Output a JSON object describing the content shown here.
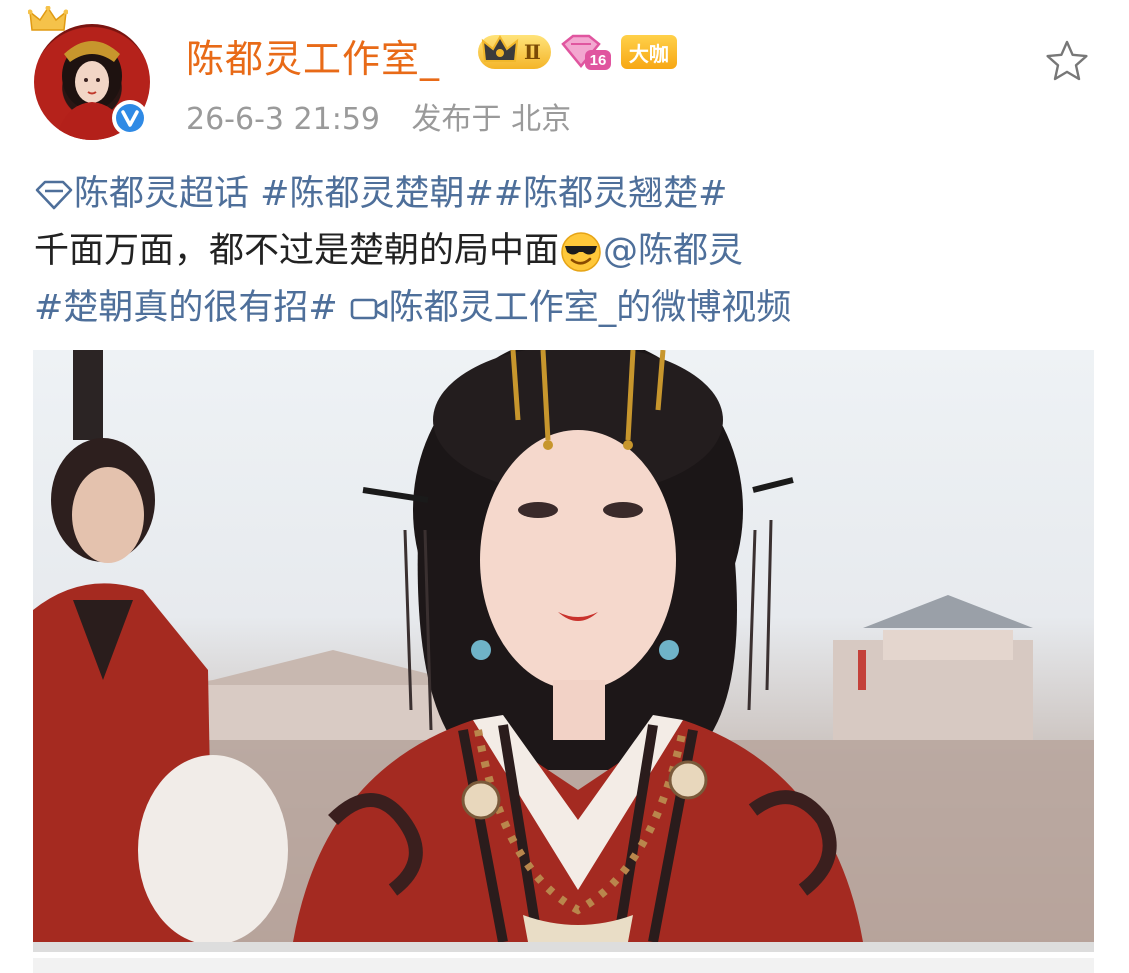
{
  "user": {
    "name": "陈都灵工作室_",
    "rank_badge": "Ⅱ",
    "level_badge": "16",
    "vip_badge": "大咖",
    "timestamp": "26-6-3 21:59",
    "location": "发布于 北京"
  },
  "post": {
    "supertopic": "陈都灵超话",
    "tag1": "#陈都灵楚朝#",
    "tag2": "#陈都灵翘楚#",
    "text": "千面万面，都不过是楚朝的局中面",
    "mention": "@陈都灵",
    "tag3": "#楚朝真的很有招#",
    "video_link": "陈都灵工作室_的微博视频"
  },
  "icons": {
    "supertopic": "diamond-icon",
    "emoji": "sunglasses-emoji-icon",
    "video": "video-camera-icon",
    "favorite": "star-icon",
    "verified": "verified-v-icon"
  },
  "colors": {
    "username": "#e86a17",
    "link": "#4e6f9a",
    "meta": "#9a9a9a"
  }
}
